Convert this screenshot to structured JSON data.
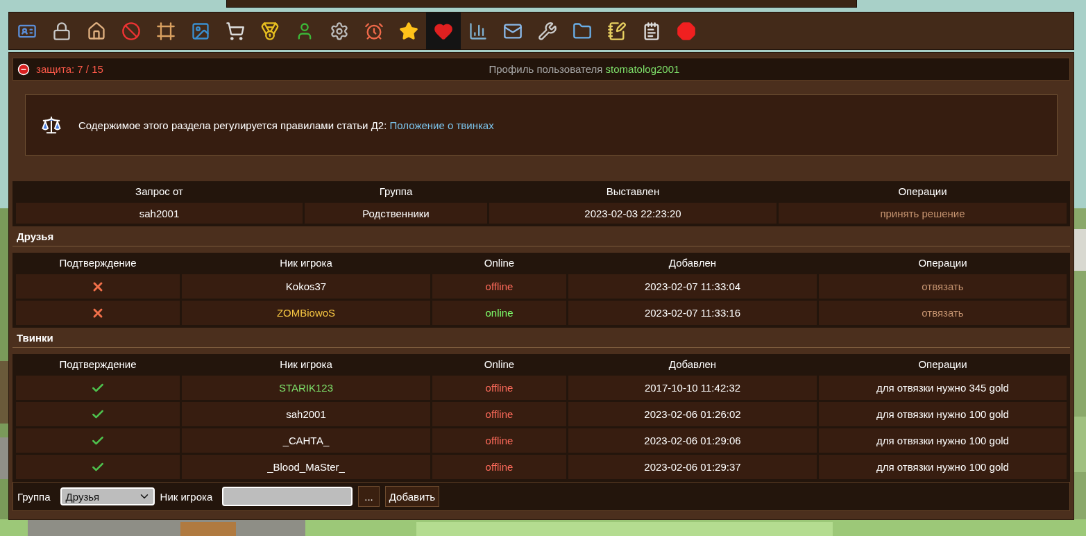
{
  "toolbar": [
    {
      "selected": false
    },
    {
      "selected": false
    },
    {
      "selected": false
    },
    {
      "selected": false
    },
    {
      "selected": false
    },
    {
      "selected": false
    },
    {
      "selected": false
    },
    {
      "selected": false
    },
    {
      "selected": false
    },
    {
      "selected": false
    },
    {
      "selected": false
    },
    {
      "selected": false
    },
    {
      "selected": true
    },
    {
      "selected": false
    },
    {
      "selected": false
    },
    {
      "selected": false
    },
    {
      "selected": false
    },
    {
      "selected": false
    },
    {
      "selected": false
    },
    {
      "selected": false
    }
  ],
  "header": {
    "protection": "защита: 7 / 15",
    "profile_label": "Профиль пользователя",
    "username": "stomatolog2001"
  },
  "notice": {
    "text": "Содержимое этого раздела регулируется правилами статьи Д2:",
    "link": "Положение о твинках"
  },
  "requests": {
    "columns": [
      "Запрос от",
      "Группа",
      "Выставлен",
      "Операции"
    ],
    "rows": [
      {
        "from": "sah2001",
        "group": "Родственники",
        "date": "2023-02-03 22:23:20",
        "action": "принять решение"
      }
    ]
  },
  "friends": {
    "title": "Друзья",
    "columns": [
      "Подтверждение",
      "Ник игрока",
      "Online",
      "Добавлен",
      "Операции"
    ],
    "rows": [
      {
        "confirmed": false,
        "nick": "Kokos37",
        "color": "#ffffff",
        "online": false,
        "status": "offline",
        "date": "2023-02-07 11:33:04",
        "action": "отвязать",
        "action_link": true
      },
      {
        "confirmed": false,
        "nick": "ZOMBiowoS",
        "color": "#f5c542",
        "online": true,
        "status": "online",
        "date": "2023-02-07 11:33:16",
        "action": "отвязать",
        "action_link": true
      }
    ]
  },
  "twinks": {
    "title": "Твинки",
    "columns": [
      "Подтверждение",
      "Ник игрока",
      "Online",
      "Добавлен",
      "Операции"
    ],
    "rows": [
      {
        "confirmed": true,
        "nick": "STARIK123",
        "color": "#7ee06a",
        "online": false,
        "status": "offline",
        "date": "2017-10-10 11:42:32",
        "action": "для отвязки нужно 345 gold",
        "action_link": false
      },
      {
        "confirmed": true,
        "nick": "sah2001",
        "color": "#ffffff",
        "online": false,
        "status": "offline",
        "date": "2023-02-06 01:26:02",
        "action": "для отвязки нужно 100 gold",
        "action_link": false
      },
      {
        "confirmed": true,
        "nick": "_САНТА_",
        "color": "#ffffff",
        "online": false,
        "status": "offline",
        "date": "2023-02-06 01:29:06",
        "action": "для отвязки нужно 100 gold",
        "action_link": false
      },
      {
        "confirmed": true,
        "nick": "_Blood_MaSter_",
        "color": "#ffffff",
        "online": false,
        "status": "offline",
        "date": "2023-02-06 01:29:37",
        "action": "для отвязки нужно 100 gold",
        "action_link": false
      }
    ]
  },
  "form": {
    "group_label": "Группа",
    "group_value": "Друзья",
    "nick_label": "Ник игрока",
    "browse_button": "...",
    "add_button": "Добавить"
  }
}
